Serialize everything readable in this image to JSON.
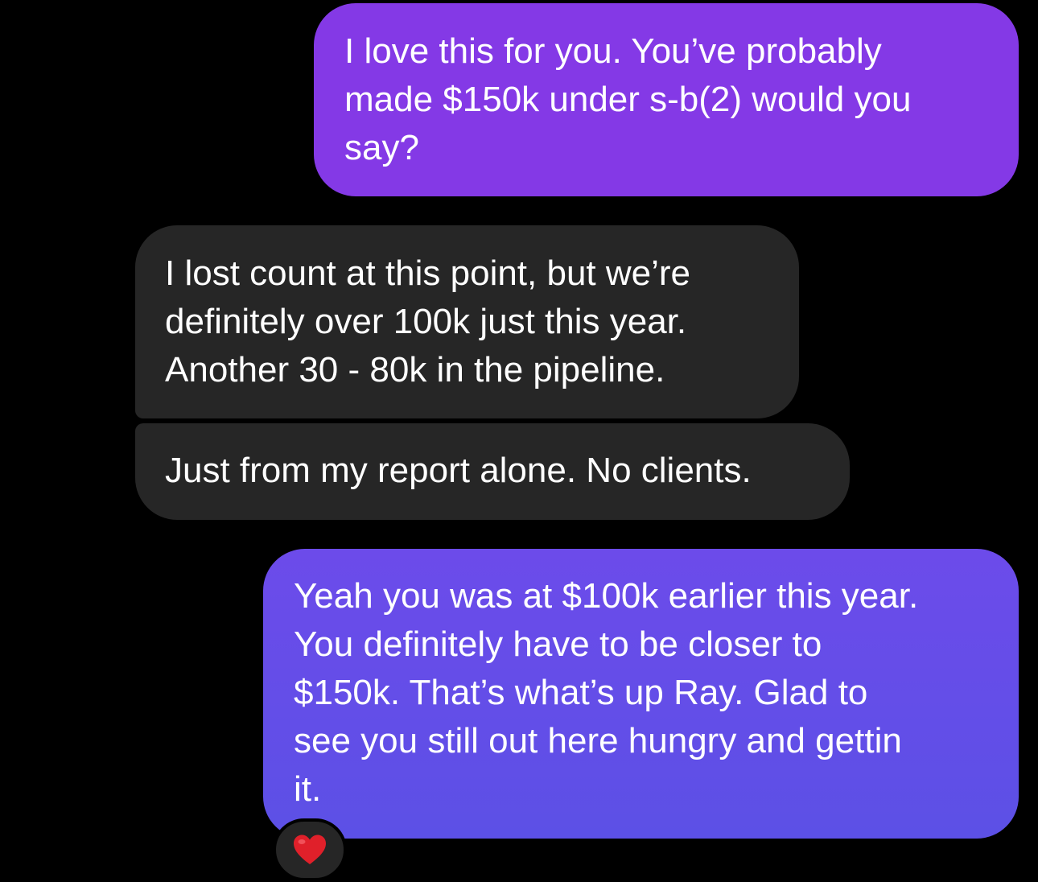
{
  "messages": [
    {
      "direction": "outgoing",
      "text": "I love this for you. You’ve probably\nmade $150k under s-b(2) would you\nsay?"
    },
    {
      "direction": "incoming",
      "text": "I lost count at this point, but we’re\ndefinitely over 100k just this year.\nAnother 30 - 80k in the pipeline."
    },
    {
      "direction": "incoming",
      "text": "Just from my report alone. No clients."
    },
    {
      "direction": "outgoing",
      "text": "Yeah you was at $100k earlier this year.\nYou definitely have to be closer to\n$150k. That’s what’s up Ray. Glad to\nsee you still out here hungry and gettin\nit."
    }
  ],
  "reaction": {
    "icon": "heart-icon",
    "color": "#e0202a"
  },
  "colors": {
    "background": "#000000",
    "outgoing_bubble_top": "#8439e6",
    "outgoing_bubble_bottom": "#5c50e6",
    "incoming_bubble": "#262626",
    "text": "#ffffff"
  }
}
